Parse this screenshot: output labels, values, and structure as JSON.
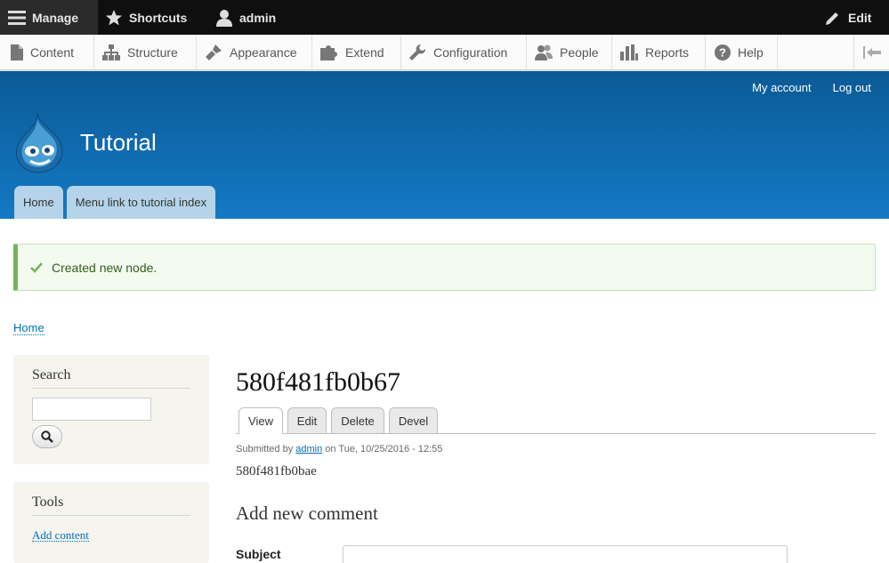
{
  "toolbar": {
    "manage": "Manage",
    "shortcuts": "Shortcuts",
    "user": "admin",
    "edit": "Edit"
  },
  "tray": {
    "items": [
      {
        "label": "Content",
        "icon": "file-icon"
      },
      {
        "label": "Structure",
        "icon": "sitemap-icon"
      },
      {
        "label": "Appearance",
        "icon": "paintbrush-icon"
      },
      {
        "label": "Extend",
        "icon": "puzzle-icon"
      },
      {
        "label": "Configuration",
        "icon": "wrench-icon"
      },
      {
        "label": "People",
        "icon": "people-icon"
      },
      {
        "label": "Reports",
        "icon": "bar-chart-icon"
      },
      {
        "label": "Help",
        "icon": "help-icon"
      }
    ]
  },
  "header": {
    "secondary": {
      "my_account": "My account",
      "log_out": "Log out"
    },
    "site_name": "Tutorial",
    "tabs": {
      "home": "Home",
      "tutorial_index": "Menu link to tutorial index"
    },
    "color": "#0f6fb5"
  },
  "message": {
    "text": "Created new node.",
    "color": "#77b259"
  },
  "breadcrumb": {
    "home": "Home"
  },
  "sidebar": {
    "search": {
      "title": "Search",
      "placeholder": ""
    },
    "tools": {
      "title": "Tools",
      "link": "Add content"
    }
  },
  "node": {
    "title": "580f481fb0b67",
    "tabs": {
      "view": "View",
      "edit": "Edit",
      "delete": "Delete",
      "devel": "Devel"
    },
    "submitted_prefix": "Submitted by",
    "author": "admin",
    "submitted_suffix": "on Tue, 10/25/2016 - 12:55",
    "body": "580f481fb0bae"
  },
  "comment": {
    "heading": "Add new comment",
    "subject_label": "Subject",
    "subject_value": ""
  }
}
